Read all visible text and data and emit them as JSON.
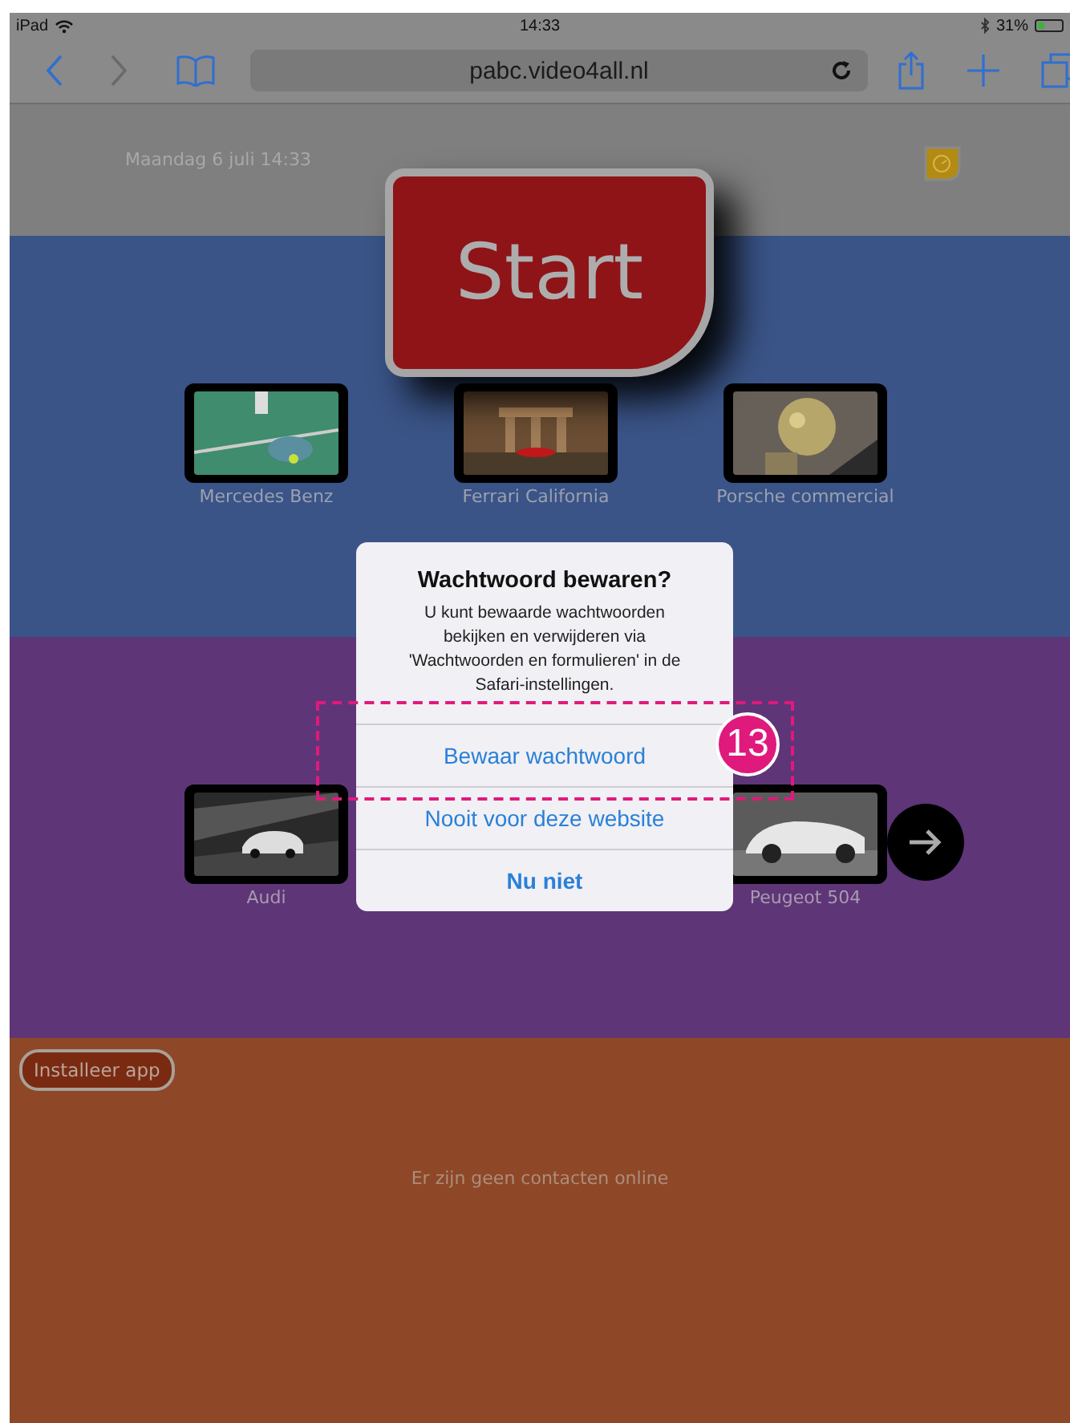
{
  "status_bar": {
    "device": "iPad",
    "time": "14:33",
    "battery": "31%"
  },
  "toolbar": {
    "url": "pabc.video4all.nl"
  },
  "header": {
    "date": "Maandag 6 juli 14:33"
  },
  "start_button": {
    "label": "Start"
  },
  "video_rows": [
    {
      "videos": [
        {
          "title": "Mercedes Benz",
          "kind": "picture"
        },
        {
          "title": "Ferrari California",
          "kind": "picture"
        },
        {
          "title": "Porsche commercial",
          "kind": "picture"
        }
      ]
    },
    {
      "videos": [
        {
          "title": "Audi",
          "kind": "picture"
        },
        {
          "title": "Peugeot 504",
          "kind": "picture"
        }
      ]
    }
  ],
  "install_button": {
    "label": "Installeer app"
  },
  "contacts_message": "Er zijn geen contacten online",
  "dialog": {
    "title": "Wachtwoord bewaren?",
    "message": "U kunt bewaarde wachtwoorden bekijken en verwijderen via 'Wachtwoorden en formulieren' in de Safari-instellingen.",
    "buttons": [
      {
        "label": "Bewaar wachtwoord",
        "kind": "default"
      },
      {
        "label": "Nooit voor deze website",
        "kind": "default"
      },
      {
        "label": "Nu niet",
        "kind": "cancel"
      }
    ]
  },
  "annotation": {
    "number": "13"
  }
}
